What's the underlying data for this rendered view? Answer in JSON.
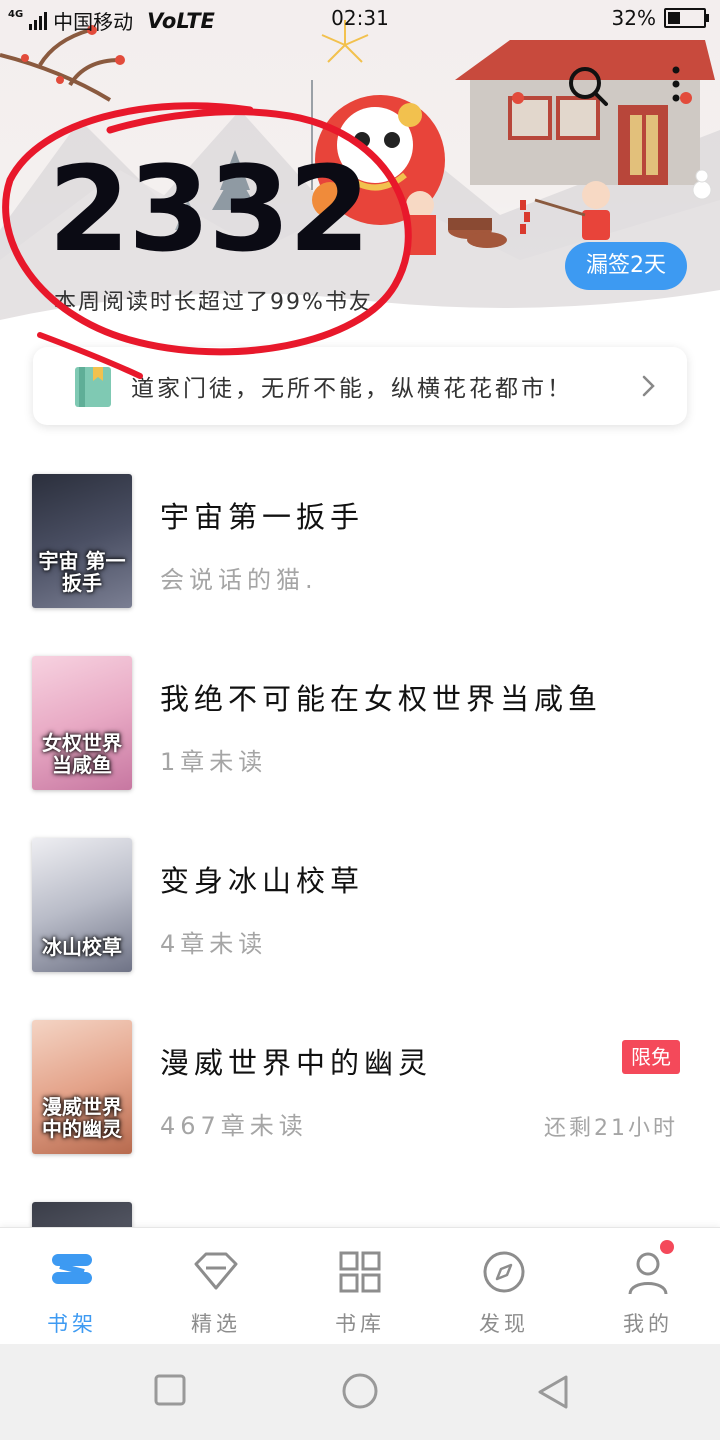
{
  "status_bar": {
    "network": "4G",
    "carrier": "中国移动",
    "volte": "VoLTE",
    "time": "02:31",
    "battery": "32%",
    "battery_level": 0.32
  },
  "header": {
    "reading_minutes": "2332",
    "caption": "本周阅读时长超过了99%书友",
    "missed_badge": "漏签2天"
  },
  "promo": {
    "text": "道家门徒，无所不能，纵横花花都市！"
  },
  "books": [
    {
      "title": "宇宙第一扳手",
      "subtitle": "会说话的猫.",
      "cover_text": "宇宙 第一扳手",
      "cover_colors": [
        "#2b2f3c",
        "#4a4f63",
        "#7b7f93"
      ]
    },
    {
      "title": "我绝不可能在女权世界当咸鱼",
      "subtitle": "1章未读",
      "cover_text": "女权世界 当咸鱼",
      "cover_colors": [
        "#f7d2e0",
        "#e8a9c4",
        "#c777a1"
      ]
    },
    {
      "title": "变身冰山校草",
      "subtitle": "4章未读",
      "cover_text": "冰山校草",
      "cover_colors": [
        "#eeeef2",
        "#b9bcc8",
        "#6f7386"
      ]
    },
    {
      "title": "漫威世界中的幽灵",
      "subtitle": "467章未读",
      "cover_text": "漫威世界 中的幽灵",
      "cover_colors": [
        "#f4d4c4",
        "#e4a38a",
        "#b76a4e"
      ],
      "tag": "限免",
      "remaining": "还剩21小时"
    },
    {
      "title": "",
      "subtitle": "",
      "cover_text": "",
      "cover_colors": [
        "#3a3d48",
        "#5b5e6b",
        "#8d8f99"
      ]
    }
  ],
  "tabs": [
    {
      "label": "书架",
      "icon": "bookshelf-icon",
      "active": true
    },
    {
      "label": "精选",
      "icon": "diamond-icon",
      "active": false
    },
    {
      "label": "书库",
      "icon": "grid-icon",
      "active": false
    },
    {
      "label": "发现",
      "icon": "compass-icon",
      "active": false
    },
    {
      "label": "我的",
      "icon": "user-icon",
      "active": false,
      "badge": true
    }
  ],
  "colors": {
    "accent": "#3d9af2",
    "tag_red": "#f4495a",
    "annotation_red": "#e8182b"
  }
}
